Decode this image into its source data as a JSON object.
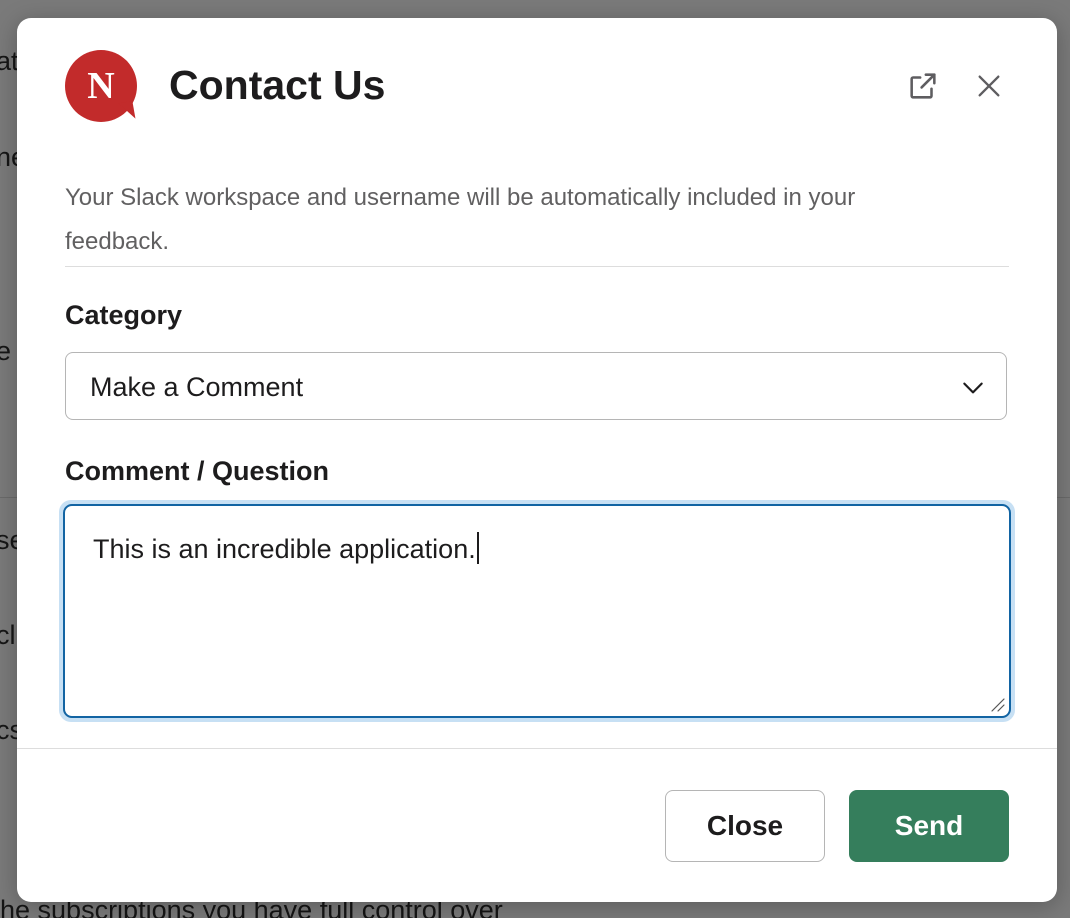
{
  "background": {
    "fragments": [
      "at",
      "ne",
      "e c",
      "se",
      "clu",
      "cs"
    ],
    "bottom_text": "he subscriptions you have full control over"
  },
  "modal": {
    "logo_letter": "N",
    "title": "Contact Us",
    "external_icon": "external-link-icon",
    "close_icon": "close-icon",
    "notice": "Your Slack workspace and username will be automatically included in your feedback.",
    "category": {
      "label": "Category",
      "selected": "Make a Comment"
    },
    "comment": {
      "label": "Comment / Question",
      "value": "This is an incredible application."
    },
    "buttons": {
      "close": "Close",
      "send": "Send"
    }
  },
  "colors": {
    "logo": "#c22b2b",
    "send": "#357e5c",
    "focus_border": "#1264a3",
    "focus_ring": "#c7e0f4"
  }
}
